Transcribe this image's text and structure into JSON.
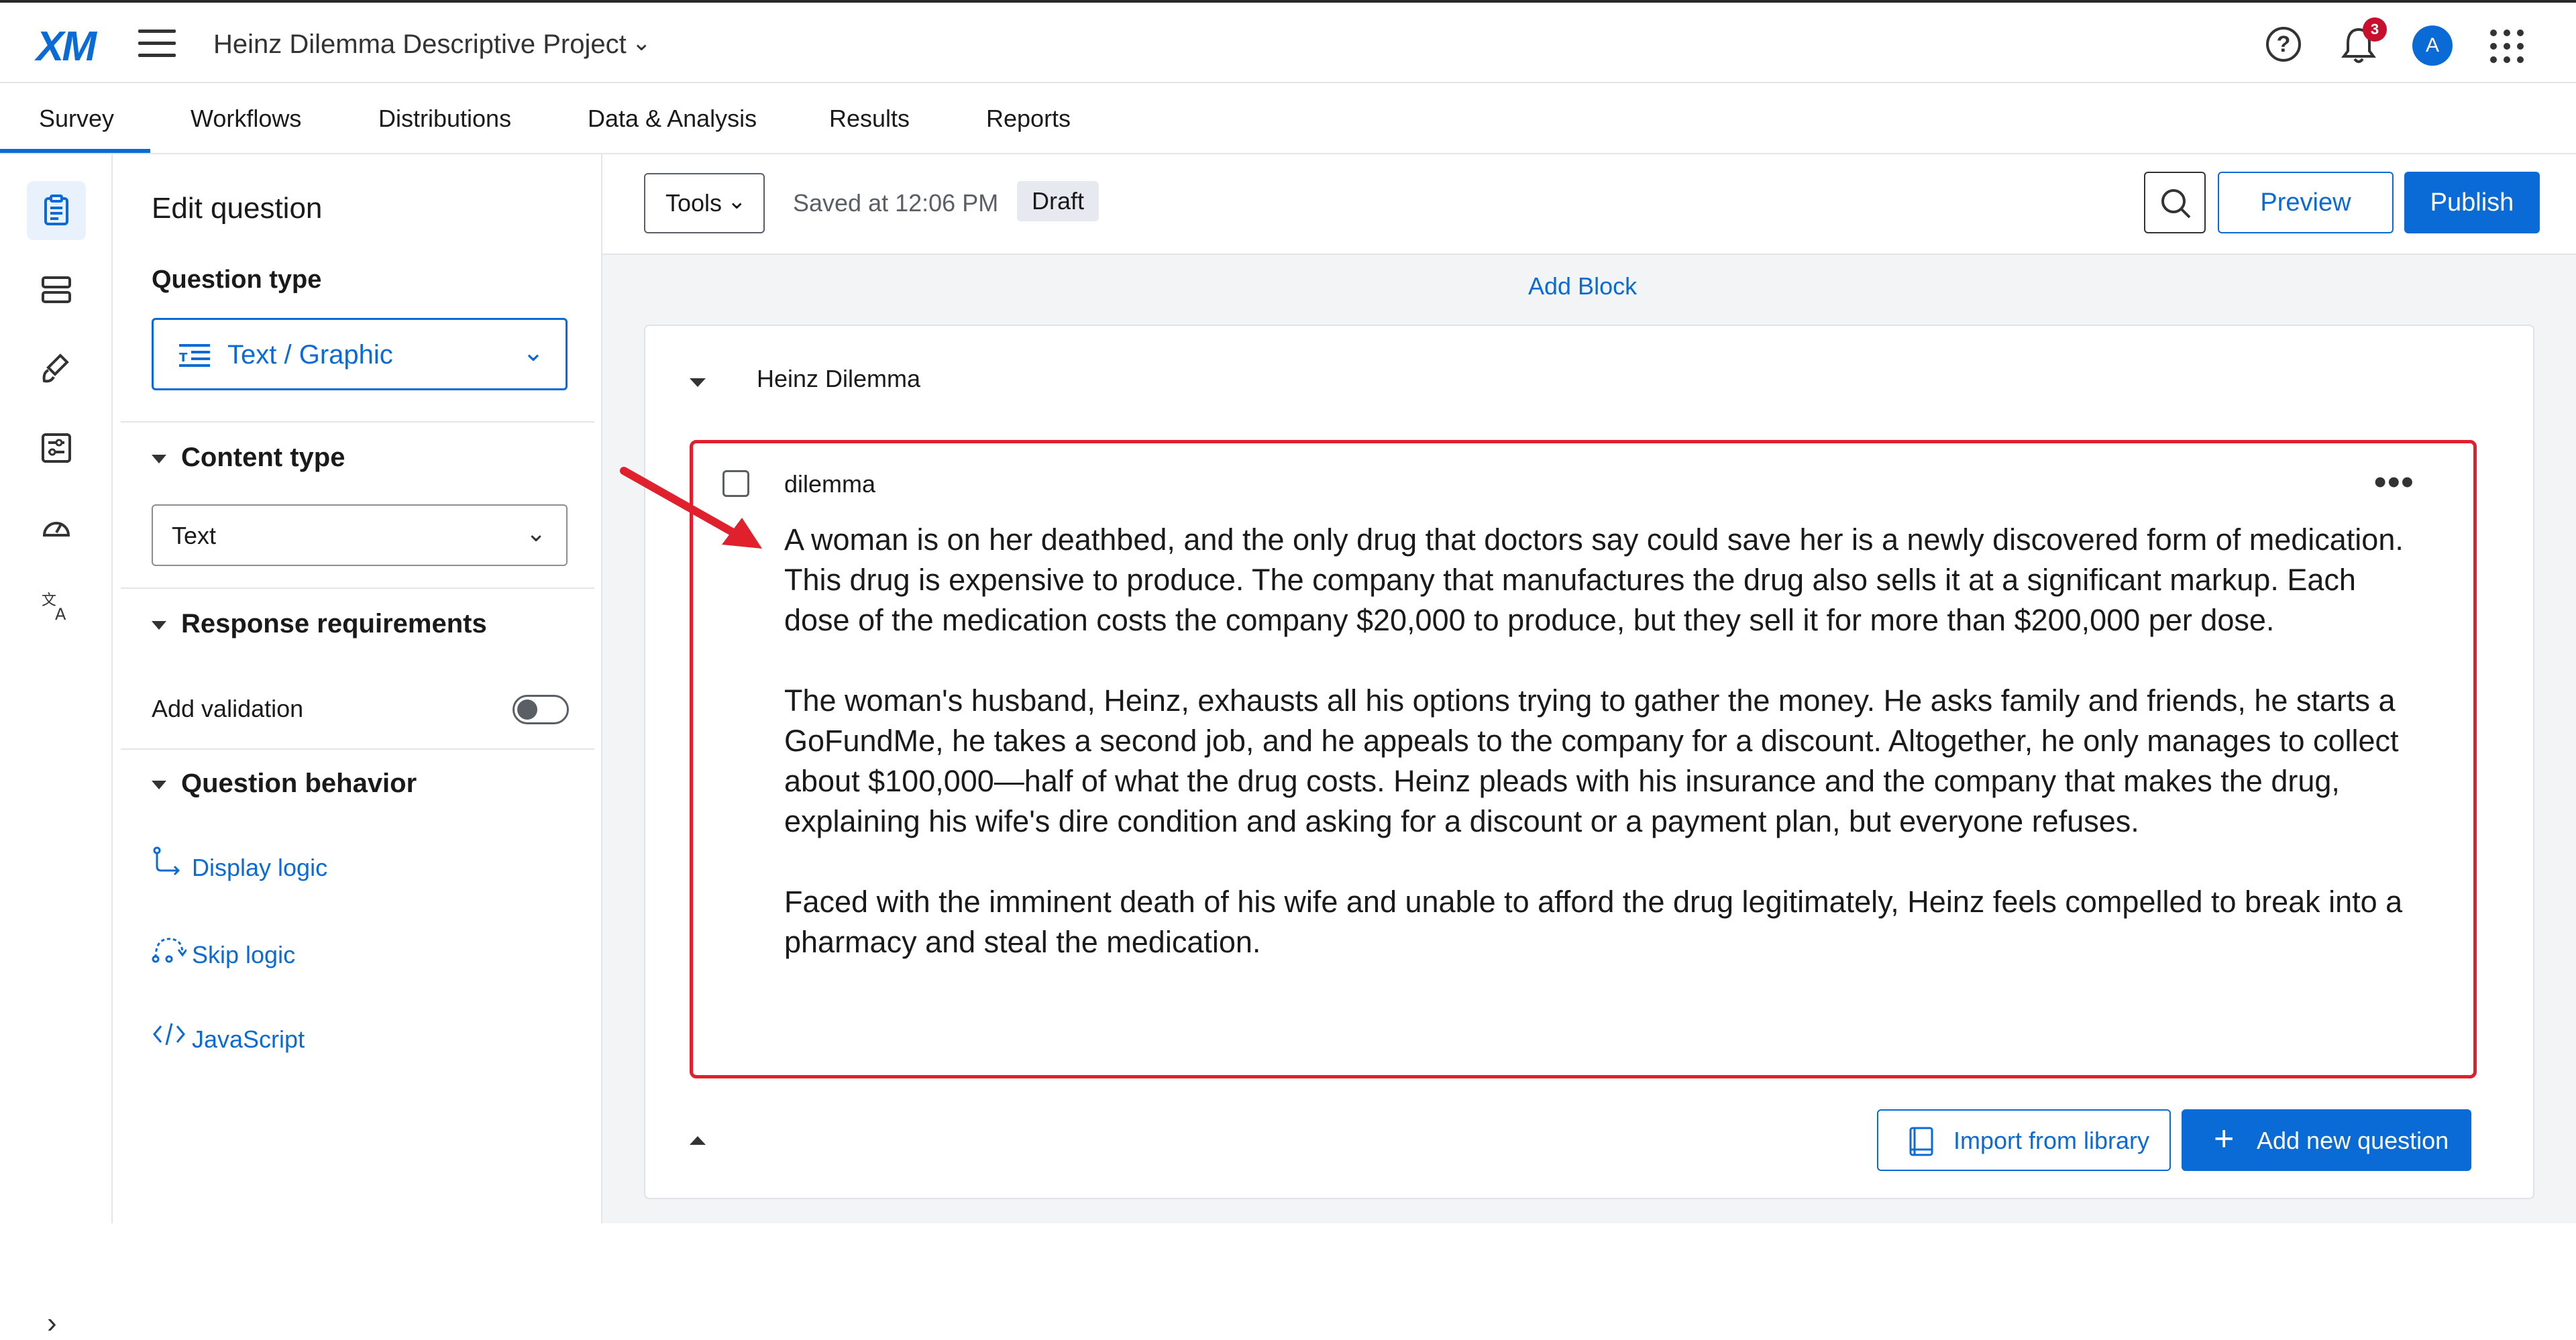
{
  "header": {
    "logo": "XM",
    "project_title": "Heinz Dilemma Descriptive Project",
    "notification_count": "3",
    "avatar_initial": "A"
  },
  "nav": {
    "tabs": [
      "Survey",
      "Workflows",
      "Distributions",
      "Data & Analysis",
      "Results",
      "Reports"
    ],
    "active_tab": "Survey"
  },
  "icon_rail": {
    "items": [
      "survey-icon",
      "blocks-icon",
      "look-and-feel-icon",
      "survey-options-icon",
      "survey-flow-gauge-icon",
      "translate-icon"
    ],
    "active": "survey-icon"
  },
  "edit_panel": {
    "title": "Edit question",
    "question_type_label": "Question type",
    "question_type_value": "Text / Graphic",
    "content_type_label": "Content type",
    "content_type_value": "Text",
    "response_requirements_label": "Response requirements",
    "add_validation_label": "Add validation",
    "add_validation_on": false,
    "question_behavior_label": "Question behavior",
    "display_logic": "Display logic",
    "skip_logic": "Skip logic",
    "javascript": "JavaScript"
  },
  "toolbar": {
    "tools_label": "Tools",
    "saved_text": "Saved at 12:06 PM",
    "status_badge": "Draft",
    "preview_label": "Preview",
    "publish_label": "Publish"
  },
  "survey": {
    "add_block_label": "Add Block",
    "block_title": "Heinz Dilemma",
    "question": {
      "id": "dilemma",
      "paragraphs": [
        "A woman is on her deathbed, and the only drug that doctors say could save her is a newly discovered form of medication. This drug is expensive to produce. The company that manufactures the drug also sells it at a significant markup. Each dose of the medication costs the company $20,000 to produce, but they sell it for more than $200,000 per dose.",
        "The woman's husband, Heinz, exhausts all his options trying to gather the money. He asks family and friends, he starts a GoFundMe, he takes a second job, and he appeals to the company for a discount. Altogether, he only manages to collect about $100,000—half of what the drug costs. Heinz pleads with his insurance and the company that makes the drug, explaining his wife's dire condition and asking for a discount or a payment plan, but everyone refuses.",
        "Faced with the imminent death of his wife and unable to afford the drug legitimately, Heinz feels compelled to break into a pharmacy and steal the medication."
      ]
    },
    "import_label": "Import from library",
    "add_question_label": "Add new question"
  },
  "colors": {
    "accent": "#0b6bd6",
    "highlight_border": "#e0202c",
    "annotation_arrow": "#e0202c"
  }
}
